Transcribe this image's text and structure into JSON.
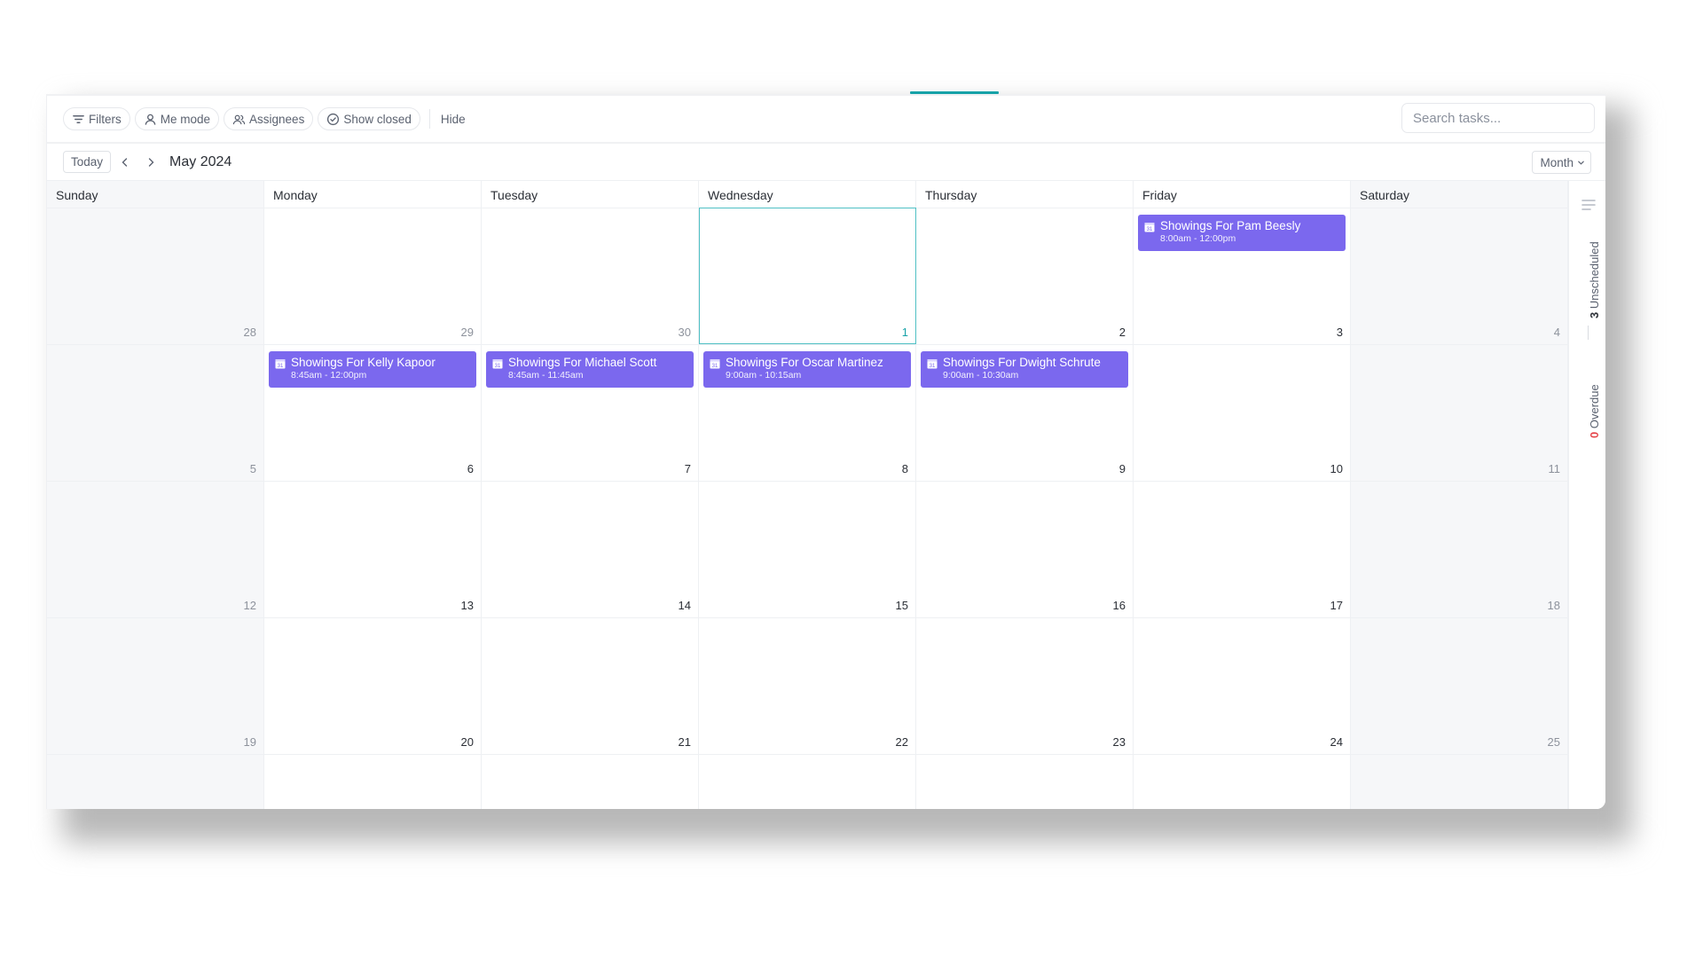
{
  "toolbar": {
    "filters": "Filters",
    "me_mode": "Me mode",
    "assignees": "Assignees",
    "show_closed": "Show closed",
    "hide": "Hide",
    "search_placeholder": "Search tasks..."
  },
  "nav": {
    "today": "Today",
    "month_title": "May 2024",
    "view": "Month"
  },
  "weekdays": [
    "Sunday",
    "Monday",
    "Tuesday",
    "Wednesday",
    "Thursday",
    "Friday",
    "Saturday"
  ],
  "weeks": [
    [
      "28",
      "29",
      "30",
      "1",
      "2",
      "3",
      "4"
    ],
    [
      "5",
      "6",
      "7",
      "8",
      "9",
      "10",
      "11"
    ],
    [
      "12",
      "13",
      "14",
      "15",
      "16",
      "17",
      "18"
    ],
    [
      "19",
      "20",
      "21",
      "22",
      "23",
      "24",
      "25"
    ],
    [
      "",
      "",
      "",
      "",
      "",
      "",
      ""
    ]
  ],
  "events": {
    "pam": {
      "title": "Showings For Pam Beesly",
      "time": "8:00am - 12:00pm"
    },
    "kelly": {
      "title": "Showings For Kelly Kapoor",
      "time": "8:45am - 12:00pm"
    },
    "michael": {
      "title": "Showings For Michael Scott",
      "time": "8:45am - 11:45am"
    },
    "oscar": {
      "title": "Showings For Oscar Martinez",
      "time": "9:00am - 10:15am"
    },
    "dwight": {
      "title": "Showings For Dwight Schrute",
      "time": "9:00am - 10:30am"
    }
  },
  "sidebar": {
    "unscheduled_count": "3",
    "unscheduled_label": "Unscheduled",
    "overdue_count": "0",
    "overdue_label": "Overdue"
  },
  "colors": {
    "accent": "#17a2a8",
    "event": "#7b68ee",
    "overdue": "#e5484d"
  }
}
